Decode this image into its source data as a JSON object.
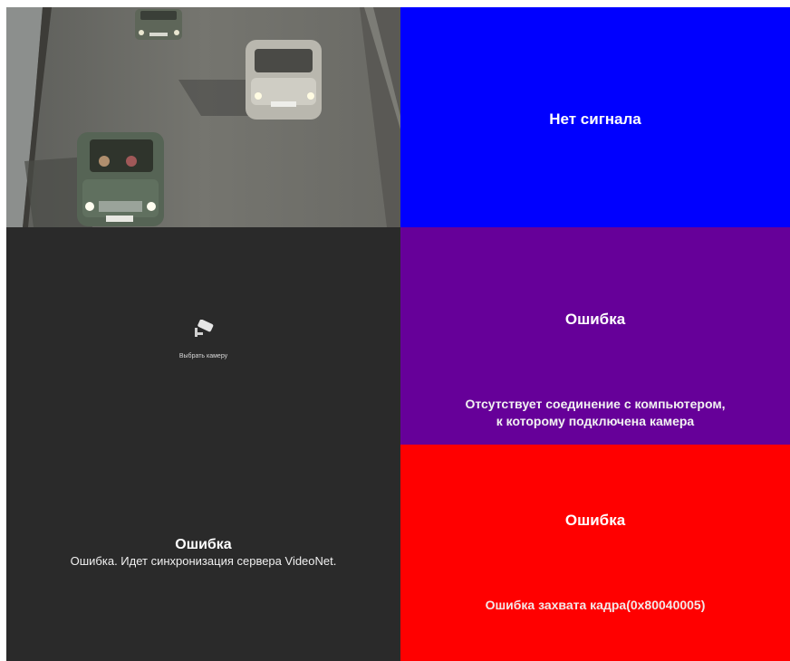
{
  "tiles": [
    {
      "kind": "camera-feed",
      "title": "",
      "message": ""
    },
    {
      "kind": "status",
      "title": "Нет сигнала",
      "message": "",
      "color": "#0000ff"
    },
    {
      "kind": "select",
      "title": "",
      "label": "Выбрать камеру",
      "icon": "camera-icon",
      "color": "#2a2a2a"
    },
    {
      "kind": "error",
      "title": "Ошибка",
      "message_line1": "Отсутствует соединение с компьютером,",
      "message_line2": "к которому подключена камера",
      "color": "#660099"
    },
    {
      "kind": "error",
      "title": "Ошибка",
      "message": "Ошибка. Идет синхронизация сервера VideoNet.",
      "color": "#2a2a2a"
    },
    {
      "kind": "error",
      "title": "Ошибка",
      "message": "Ошибка захвата кадра(0x80040005)",
      "color": "#ff0000"
    }
  ]
}
